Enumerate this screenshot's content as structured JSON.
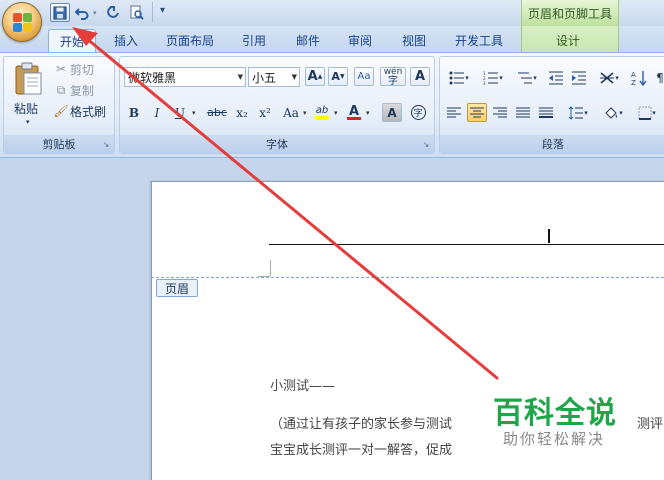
{
  "quick_access": {
    "save_icon": "save-icon",
    "undo_icon": "undo-icon",
    "redo_icon": "redo-icon",
    "print_preview_icon": "print-preview-icon",
    "customize_icon": "customize-qat-icon"
  },
  "context_tab_group": {
    "title": "页眉和页脚工具",
    "tab": "设计"
  },
  "tabs": [
    "开始",
    "插入",
    "页面布局",
    "引用",
    "邮件",
    "审阅",
    "视图",
    "开发工具"
  ],
  "active_tab": "开始",
  "clipboard": {
    "label": "剪贴板",
    "paste": "粘贴",
    "cut": "剪切",
    "copy": "复制",
    "format_painter": "格式刷"
  },
  "font": {
    "label": "字体",
    "font_name": "微软雅黑",
    "font_size": "小五",
    "grow": "A",
    "shrink": "A",
    "bold": "B",
    "italic": "I",
    "underline": "U",
    "strike": "abc",
    "subscript": "x₂",
    "superscript": "x²",
    "change_case": "Aa",
    "highlight": "ab",
    "font_color": "A",
    "phonetic": "wén",
    "char_shading": "A",
    "char_border": "A",
    "enclose": "字"
  },
  "paragraph": {
    "label": "段落"
  },
  "document": {
    "header_tag": "页眉",
    "line1": "小测试——",
    "line2": "（通过让有孩子的家长参与测试",
    "line2_tail": "测评",
    "line3": "宝宝成长测评一对一解答，促成"
  },
  "watermark": {
    "title": "百科全说",
    "subtitle": "助你轻松解决"
  },
  "colors": {
    "accent": "#15428b",
    "arrow": "#e53c3c",
    "watermark_green": "#1fa64a",
    "highlight_yellow": "#ffff00",
    "font_red": "#e02020"
  }
}
